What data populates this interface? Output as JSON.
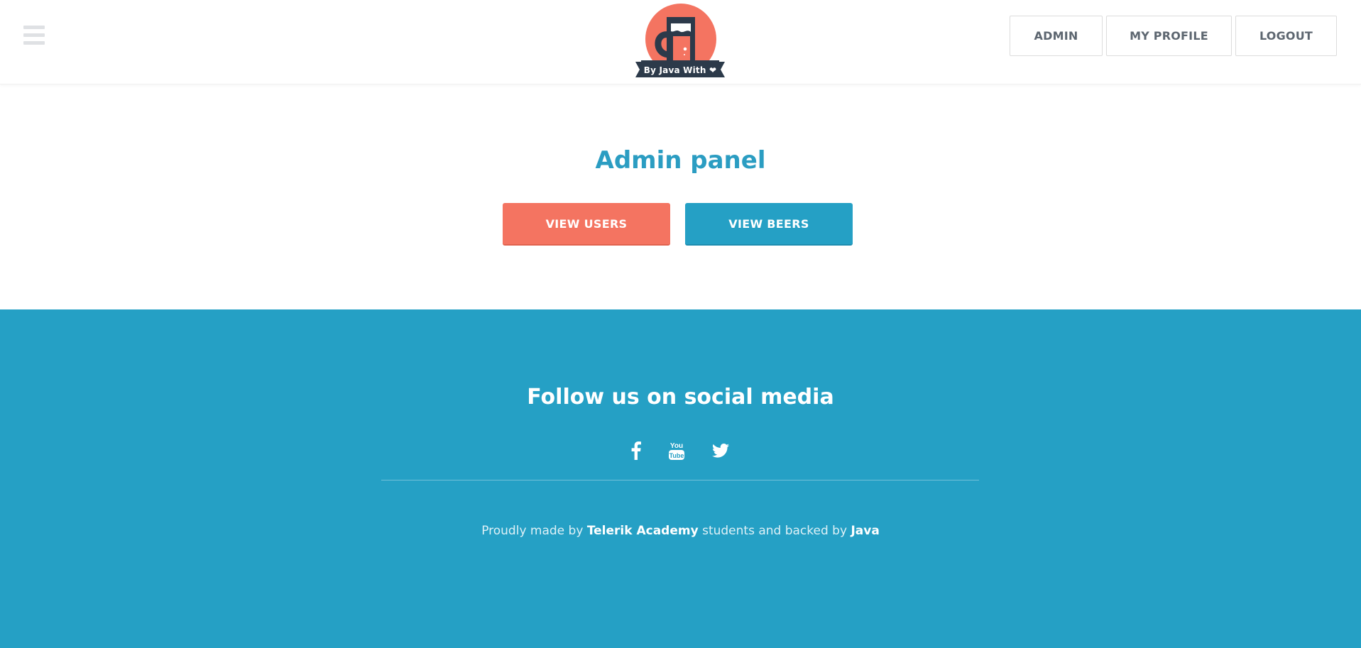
{
  "header": {
    "menu_icon": "hamburger-menu-icon",
    "logo": {
      "icon": "beer-mug-door-logo",
      "tagline": "By Java With",
      "tagline_icon": "heart-icon",
      "colors": {
        "circle": "#f47461",
        "dark": "#2c3a4a"
      }
    },
    "nav": {
      "admin_label": "ADMIN",
      "profile_label": "MY PROFILE",
      "logout_label": "LOGOUT"
    }
  },
  "main": {
    "title": "Admin panel",
    "view_users_label": "VIEW USERS",
    "view_beers_label": "VIEW BEERS"
  },
  "footer": {
    "title": "Follow us on social media",
    "social": [
      {
        "name": "facebook",
        "icon": "facebook-icon"
      },
      {
        "name": "youtube",
        "icon": "youtube-icon"
      },
      {
        "name": "twitter",
        "icon": "twitter-icon"
      }
    ],
    "credits": {
      "prefix": "Proudly made by",
      "academy": "Telerik Academy",
      "middle": "students and backed by",
      "backer": "Java"
    }
  },
  "colors": {
    "accent_blue": "#25a0c5",
    "accent_coral": "#f47461",
    "title_blue": "#2b9dc2"
  }
}
